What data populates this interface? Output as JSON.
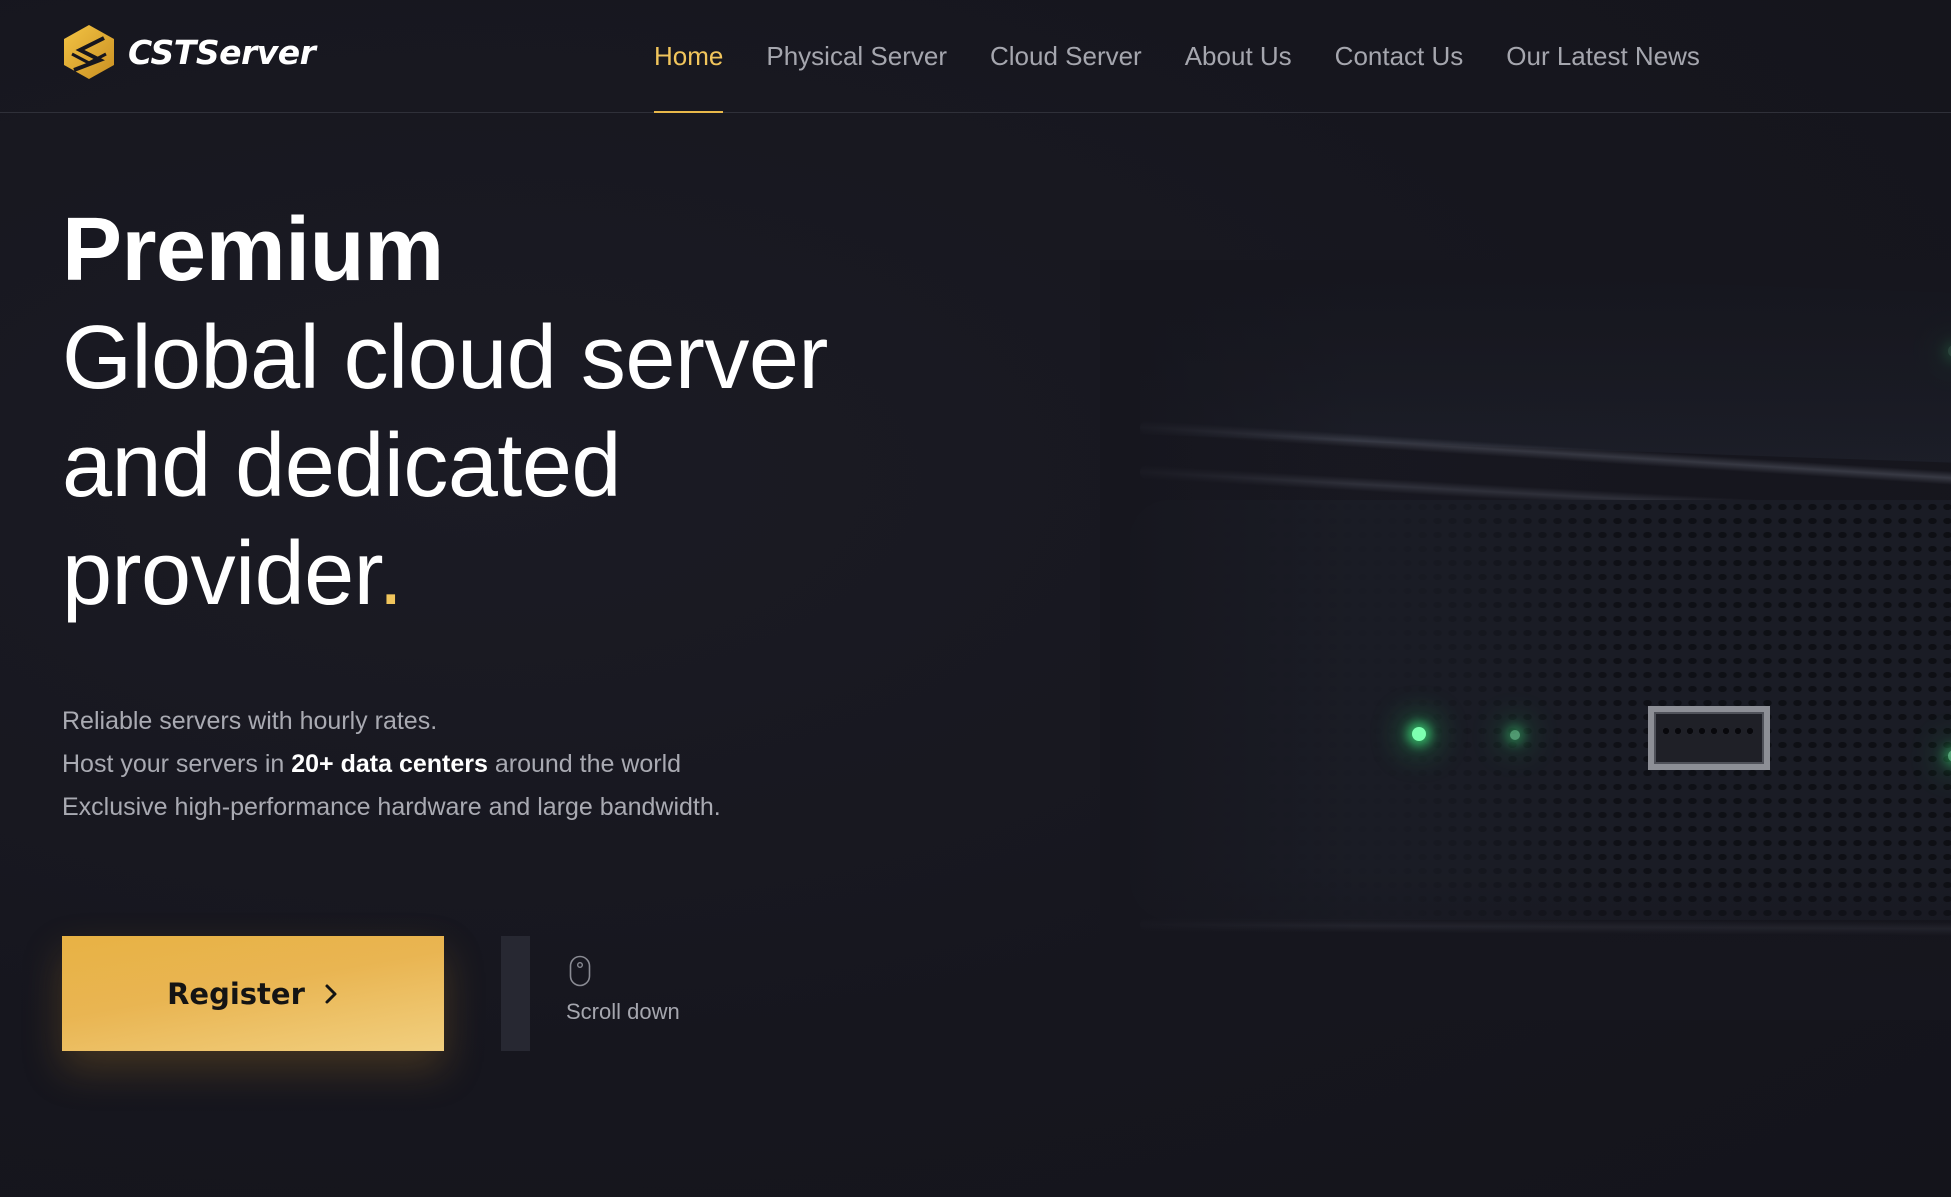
{
  "brand": {
    "name": "CSTServer",
    "logo_icon": "hexagon-s-logo-icon",
    "accent_color": "#f1c55c"
  },
  "nav": {
    "items": [
      {
        "label": "Home",
        "active": true
      },
      {
        "label": "Physical Server",
        "active": false
      },
      {
        "label": "Cloud Server",
        "active": false
      },
      {
        "label": "About Us",
        "active": false
      },
      {
        "label": "Contact Us",
        "active": false
      },
      {
        "label": "Our Latest News",
        "active": false
      }
    ]
  },
  "hero": {
    "title_strong": "Premium",
    "title_lines": [
      "Global cloud server",
      "and dedicated",
      "provider"
    ],
    "title_end_mark": ".",
    "description": {
      "line1": "Reliable servers with hourly rates.",
      "line2_prefix": "Host your servers in ",
      "line2_highlight": "20+ data centers",
      "line2_suffix": " around the world",
      "line3": "Exclusive high-performance hardware and large bandwidth."
    },
    "register_button": {
      "label": "Register",
      "icon": "chevron-right-icon"
    },
    "scroll_hint": {
      "label": "Scroll down",
      "icon": "mouse-icon"
    }
  }
}
